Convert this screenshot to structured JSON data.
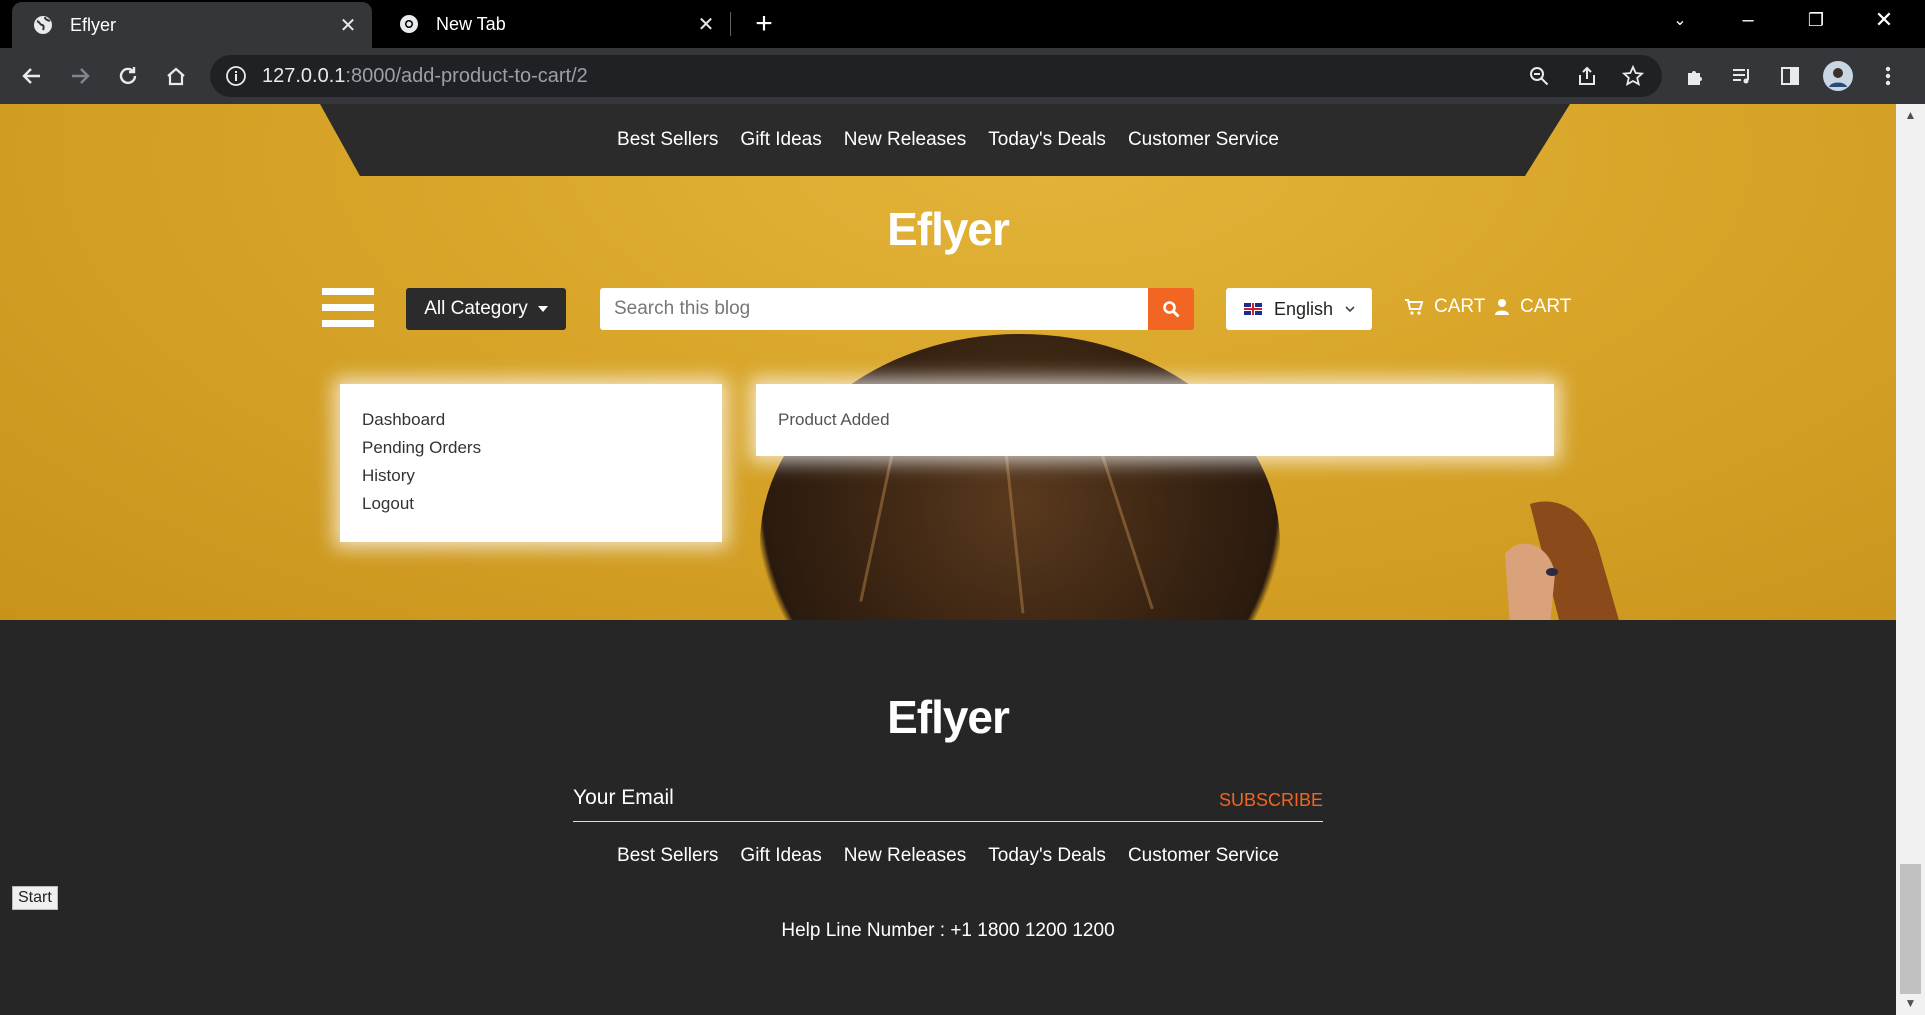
{
  "browser": {
    "tabs": [
      {
        "title": "Eflyer",
        "active": true
      },
      {
        "title": "New Tab",
        "active": false
      }
    ],
    "url_host": "127.0.0.1",
    "url_path": ":8000/add-product-to-cart/2"
  },
  "site": {
    "nav": [
      "Best Sellers",
      "Gift Ideas",
      "New Releases",
      "Today's Deals",
      "Customer Service"
    ],
    "logo": "Eflyer",
    "category_button": "All Category",
    "search_placeholder": "Search this blog",
    "language": "English",
    "cart_label_1": "CART",
    "cart_label_2": "CART",
    "account_menu": [
      "Dashboard",
      "Pending Orders",
      "History",
      "Logout"
    ],
    "message": "Product Added",
    "accent_color": "#f26522"
  },
  "footer": {
    "logo": "Eflyer",
    "email_placeholder": "Your Email",
    "subscribe_label": "SUBSCRIBE",
    "nav": [
      "Best Sellers",
      "Gift Ideas",
      "New Releases",
      "Today's Deals",
      "Customer Service"
    ],
    "helpline": "Help Line Number : +1 1800 1200 1200"
  },
  "taskbar": {
    "start_label": "Start"
  }
}
